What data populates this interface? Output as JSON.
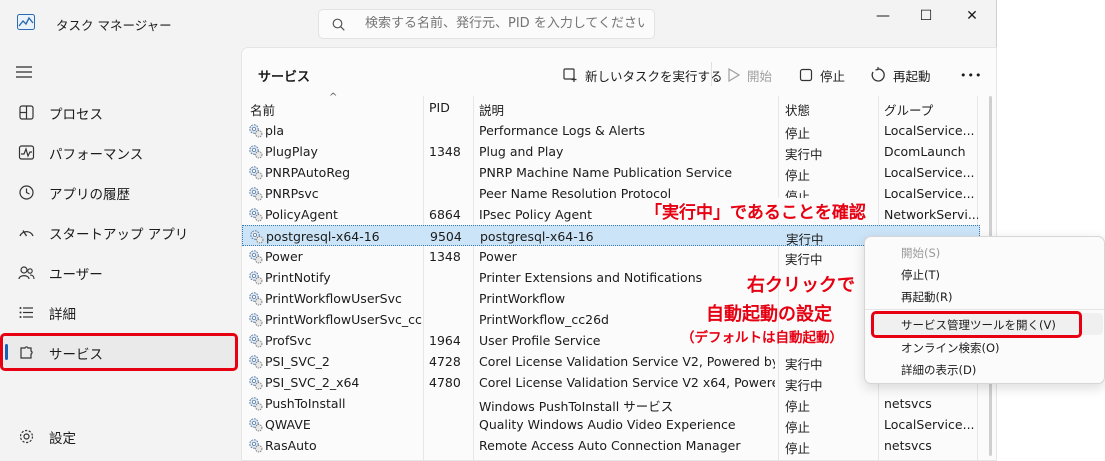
{
  "app": {
    "title": "タスク マネージャー",
    "icon": "task-manager-chart-icon"
  },
  "search": {
    "placeholder": "検索する名前、発行元、PID を入力してください"
  },
  "window_controls": {
    "minimize": "—",
    "maximize": "☐",
    "close": "✕"
  },
  "sidebar": {
    "items": [
      {
        "label": "プロセス",
        "icon": "processes-grid-icon"
      },
      {
        "label": "パフォーマンス",
        "icon": "performance-pulse-icon"
      },
      {
        "label": "アプリの履歴",
        "icon": "history-clock-icon"
      },
      {
        "label": "スタートアップ アプリ",
        "icon": "startup-speedometer-icon"
      },
      {
        "label": "ユーザー",
        "icon": "users-icon"
      },
      {
        "label": "詳細",
        "icon": "details-list-icon"
      },
      {
        "label": "サービス",
        "icon": "services-puzzle-icon",
        "active": true
      }
    ],
    "settings": {
      "label": "設定",
      "icon": "gear-icon"
    }
  },
  "page": {
    "title": "サービス"
  },
  "toolbar": {
    "new_task": "新しいタスクを実行する",
    "start": "開始",
    "stop": "停止",
    "restart": "再起動",
    "more": "•••"
  },
  "table": {
    "headers": {
      "name": "名前",
      "pid": "PID",
      "description": "説明",
      "status": "状態",
      "group": "グループ"
    },
    "rows": [
      {
        "name": "pla",
        "pid": "",
        "description": "Performance Logs & Alerts",
        "status": "停止",
        "group": "LocalService..."
      },
      {
        "name": "PlugPlay",
        "pid": "1348",
        "description": "Plug and Play",
        "status": "実行中",
        "group": "DcomLaunch"
      },
      {
        "name": "PNRPAutoReg",
        "pid": "",
        "description": "PNRP Machine Name Publication Service",
        "status": "停止",
        "group": "LocalService..."
      },
      {
        "name": "PNRPsvc",
        "pid": "",
        "description": "Peer Name Resolution Protocol",
        "status": "停止",
        "group": "LocalService..."
      },
      {
        "name": "PolicyAgent",
        "pid": "6864",
        "description": "IPsec Policy Agent",
        "status": "",
        "group": "NetworkServi..."
      },
      {
        "name": "postgresql-x64-16",
        "pid": "9504",
        "description": "postgresql-x64-16",
        "status": "実行中",
        "group": "",
        "selected": true
      },
      {
        "name": "Power",
        "pid": "1348",
        "description": "Power",
        "status": "実行中",
        "group": ""
      },
      {
        "name": "PrintNotify",
        "pid": "",
        "description": "Printer Extensions and Notifications",
        "status": "",
        "group": ""
      },
      {
        "name": "PrintWorkflowUserSvc",
        "pid": "",
        "description": "PrintWorkflow",
        "status": "",
        "group": ""
      },
      {
        "name": "PrintWorkflowUserSvc_cc...",
        "pid": "",
        "description": "PrintWorkflow_cc26d",
        "status": "",
        "group": ""
      },
      {
        "name": "ProfSvc",
        "pid": "1964",
        "description": "User Profile Service",
        "status": "",
        "group": ""
      },
      {
        "name": "PSI_SVC_2",
        "pid": "4728",
        "description": "Corel License Validation Service V2, Powered by ...",
        "status": "実行中",
        "group": ""
      },
      {
        "name": "PSI_SVC_2_x64",
        "pid": "4780",
        "description": "Corel License Validation Service V2 x64, Powere...",
        "status": "実行中",
        "group": ""
      },
      {
        "name": "PushToInstall",
        "pid": "",
        "description": "Windows PushToInstall サービス",
        "status": "停止",
        "group": "netsvcs"
      },
      {
        "name": "QWAVE",
        "pid": "",
        "description": "Quality Windows Audio Video Experience",
        "status": "停止",
        "group": "LocalService..."
      },
      {
        "name": "RasAuto",
        "pid": "",
        "description": "Remote Access Auto Connection Manager",
        "status": "停止",
        "group": "netsvcs"
      }
    ]
  },
  "context_menu": {
    "items": [
      {
        "label": "開始(S)",
        "disabled": true
      },
      {
        "label": "停止(T)"
      },
      {
        "label": "再起動(R)"
      },
      {
        "label": "サービス管理ツールを開く(V)",
        "highlighted": true
      },
      {
        "label": "オンライン検索(O)"
      },
      {
        "label": "詳細の表示(D)"
      }
    ]
  },
  "annotations": {
    "status_check": "「実行中」であることを確認",
    "right_click_line1": "右クリックで",
    "right_click_line2": "自動起動の設定",
    "default_note": "（デフォルトは自動起動）",
    "color": "#e60012"
  }
}
